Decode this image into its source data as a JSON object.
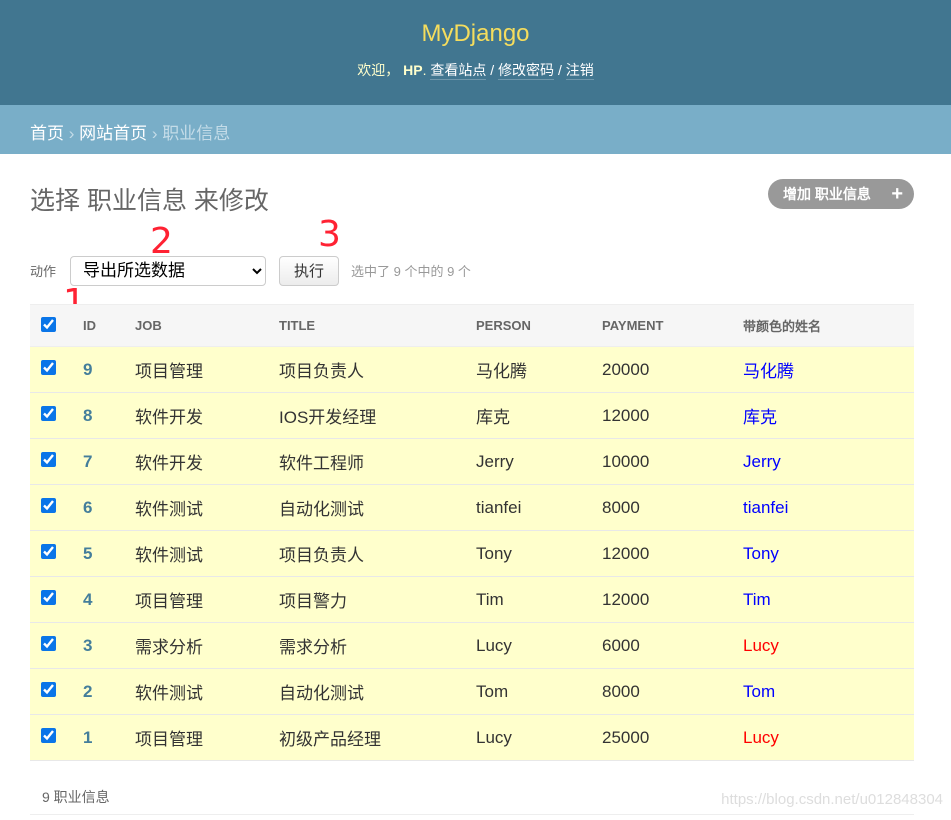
{
  "header": {
    "brand": "MyDjango",
    "welcome": "欢迎，",
    "user": "HP",
    "links": [
      "查看站点",
      "修改密码",
      "注销"
    ]
  },
  "breadcrumbs": [
    "首页",
    "网站首页",
    "职业信息"
  ],
  "page": {
    "title": "选择 职业信息 来修改",
    "add_label": "增加 职业信息",
    "add_icon": "plus-icon"
  },
  "actions": {
    "label": "动作",
    "selected": "导出所选数据",
    "go": "执行",
    "counter": "选中了 9 个中的 9 个"
  },
  "annotations": [
    "1",
    "2",
    "3"
  ],
  "table": {
    "columns": [
      "ID",
      "JOB",
      "TITLE",
      "PERSON",
      "PAYMENT",
      "带颜色的姓名"
    ],
    "rows": [
      {
        "id": "9",
        "job": "项目管理",
        "title": "项目负责人",
        "person": "马化腾",
        "payment": "20000",
        "colored": "马化腾",
        "color": "#0000ff"
      },
      {
        "id": "8",
        "job": "软件开发",
        "title": "IOS开发经理",
        "person": "库克",
        "payment": "12000",
        "colored": "库克",
        "color": "#0000ff"
      },
      {
        "id": "7",
        "job": "软件开发",
        "title": "软件工程师",
        "person": "Jerry",
        "payment": "10000",
        "colored": "Jerry",
        "color": "#0000ff"
      },
      {
        "id": "6",
        "job": "软件测试",
        "title": "自动化测试",
        "person": "tianfei",
        "payment": "8000",
        "colored": "tianfei",
        "color": "#0000ff"
      },
      {
        "id": "5",
        "job": "软件测试",
        "title": "项目负责人",
        "person": "Tony",
        "payment": "12000",
        "colored": "Tony",
        "color": "#0000ff"
      },
      {
        "id": "4",
        "job": "项目管理",
        "title": "项目警力",
        "person": "Tim",
        "payment": "12000",
        "colored": "Tim",
        "color": "#0000ff"
      },
      {
        "id": "3",
        "job": "需求分析",
        "title": "需求分析",
        "person": "Lucy",
        "payment": "6000",
        "colored": "Lucy",
        "color": "#ff0000"
      },
      {
        "id": "2",
        "job": "软件测试",
        "title": "自动化测试",
        "person": "Tom",
        "payment": "8000",
        "colored": "Tom",
        "color": "#0000ff"
      },
      {
        "id": "1",
        "job": "项目管理",
        "title": "初级产品经理",
        "person": "Lucy",
        "payment": "25000",
        "colored": "Lucy",
        "color": "#ff0000"
      }
    ]
  },
  "paginator": "9 职业信息",
  "watermark": "https://blog.csdn.net/u012848304"
}
